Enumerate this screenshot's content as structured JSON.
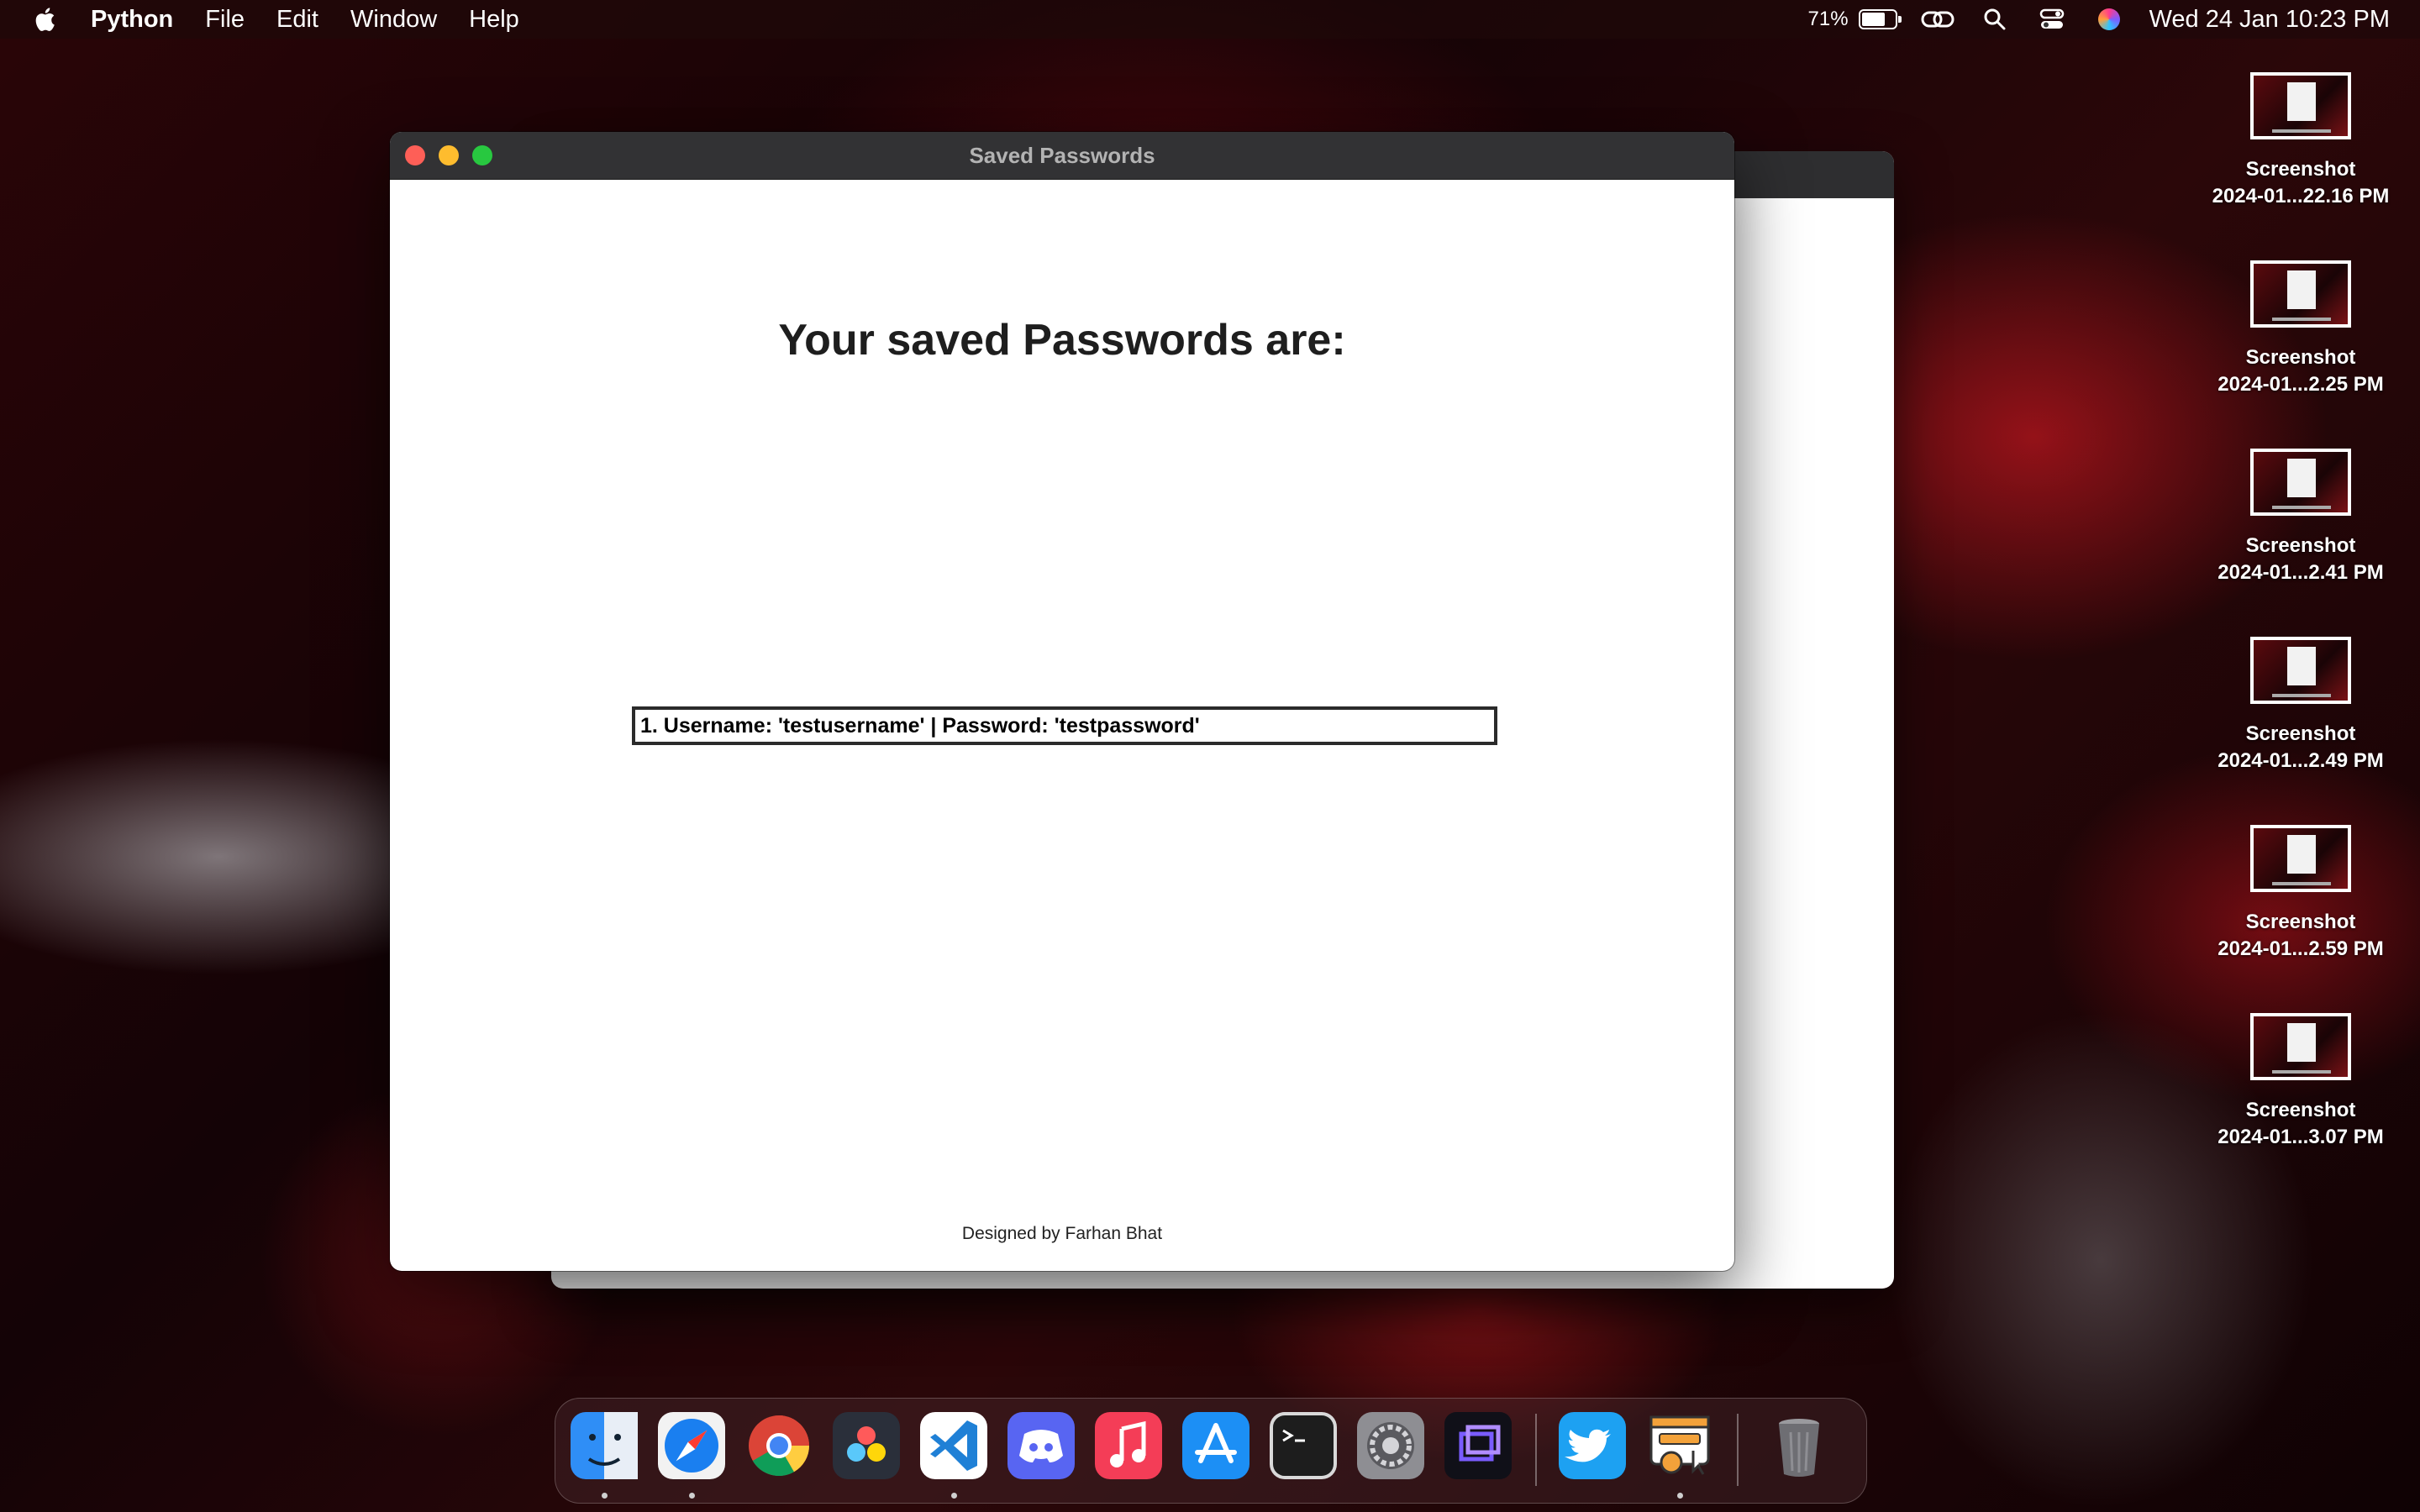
{
  "menubar": {
    "apple_icon": "apple-logo-icon",
    "app_name": "Python",
    "menus": [
      "File",
      "Edit",
      "Window",
      "Help"
    ],
    "battery_percent": "71%",
    "battery_level": 0.71,
    "status_icons": [
      "link-icon",
      "search-icon",
      "control-center-icon",
      "siri-icon"
    ],
    "clock": "Wed 24 Jan  10:23 PM"
  },
  "window": {
    "title": "Saved Passwords",
    "heading": "Your saved Passwords are:",
    "entries": [
      "1. Username: 'testusername' | Password: 'testpassword'"
    ],
    "footer": "Designed by Farhan Bhat"
  },
  "desktop": {
    "files": [
      {
        "line1": "Screenshot",
        "line2": "2024-01...22.16 PM"
      },
      {
        "line1": "Screenshot",
        "line2": "2024-01...2.25 PM"
      },
      {
        "line1": "Screenshot",
        "line2": "2024-01...2.41 PM"
      },
      {
        "line1": "Screenshot",
        "line2": "2024-01...2.49 PM"
      },
      {
        "line1": "Screenshot",
        "line2": "2024-01...2.59 PM"
      },
      {
        "line1": "Screenshot",
        "line2": "2024-01...3.07 PM"
      }
    ]
  },
  "dock": {
    "apps": [
      {
        "icon": "finder-icon",
        "color": "#2f8ef6",
        "running": true
      },
      {
        "icon": "safari-icon",
        "color": "#1a7ff0",
        "running": true
      },
      {
        "icon": "chrome-icon",
        "color": "#ffffff",
        "running": false
      },
      {
        "icon": "davinci-resolve-icon",
        "color": "#2a2f3a",
        "running": false
      },
      {
        "icon": "vscode-icon",
        "color": "#ffffff",
        "running": true
      },
      {
        "icon": "discord-icon",
        "color": "#5865f2",
        "running": false
      },
      {
        "icon": "music-icon",
        "color": "#f43d57",
        "running": false
      },
      {
        "icon": "app-store-icon",
        "color": "#1c8ff5",
        "running": false
      },
      {
        "icon": "terminal-icon",
        "color": "#1d1d1d",
        "running": false
      },
      {
        "icon": "system-settings-icon",
        "color": "#8e8e93",
        "running": false
      },
      {
        "icon": "screen-capture-icon",
        "color": "#101018",
        "running": false
      },
      {
        "icon": "twitter-icon",
        "color": "#1da1f2",
        "running": false
      },
      {
        "icon": "python-launcher-icon",
        "color": "#f3a23a",
        "running": true
      },
      {
        "icon": "trash-icon",
        "color": "#8a8a8e",
        "running": false
      }
    ]
  }
}
